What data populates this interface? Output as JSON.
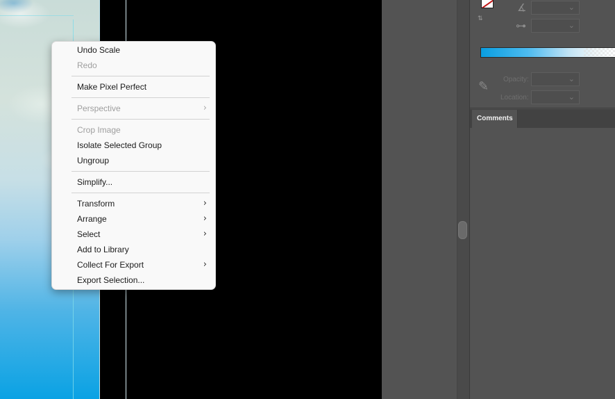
{
  "context_menu": {
    "items": [
      {
        "label": "Undo Scale",
        "enabled": true,
        "submenu": false
      },
      {
        "label": "Redo",
        "enabled": false,
        "submenu": false
      },
      {
        "label": "Make Pixel Perfect",
        "enabled": true,
        "submenu": false
      },
      {
        "label": "Perspective",
        "enabled": false,
        "submenu": true
      },
      {
        "label": "Crop Image",
        "enabled": false,
        "submenu": false
      },
      {
        "label": "Isolate Selected Group",
        "enabled": true,
        "submenu": false
      },
      {
        "label": "Ungroup",
        "enabled": true,
        "submenu": false
      },
      {
        "label": "Simplify...",
        "enabled": true,
        "submenu": false
      },
      {
        "label": "Transform",
        "enabled": true,
        "submenu": true
      },
      {
        "label": "Arrange",
        "enabled": true,
        "submenu": true
      },
      {
        "label": "Select",
        "enabled": true,
        "submenu": true
      },
      {
        "label": "Add to Library",
        "enabled": true,
        "submenu": false
      },
      {
        "label": "Collect For Export",
        "enabled": true,
        "submenu": true
      },
      {
        "label": "Export Selection...",
        "enabled": true,
        "submenu": false
      }
    ],
    "submenu_arrow": "›"
  },
  "gradient_panel": {
    "opacity_label": "Opacity:",
    "location_label": "Location:",
    "dropdown_arrow": "⌄",
    "gradient_colors": [
      "#0a9ee0",
      "#4dbbf0",
      "#bfe2f4",
      "#ffffff"
    ]
  },
  "panel_tabs": {
    "comments": "Comments"
  },
  "icons": {
    "angle": "∡",
    "aspect": "⊶",
    "eyedropper": "✎",
    "swap": "⇅"
  },
  "colors": {
    "canvas_bg": "#000000",
    "panel_bg": "#535353",
    "menu_bg": "#f9f9f9",
    "fill_swatch_stroke": "#c01818"
  }
}
